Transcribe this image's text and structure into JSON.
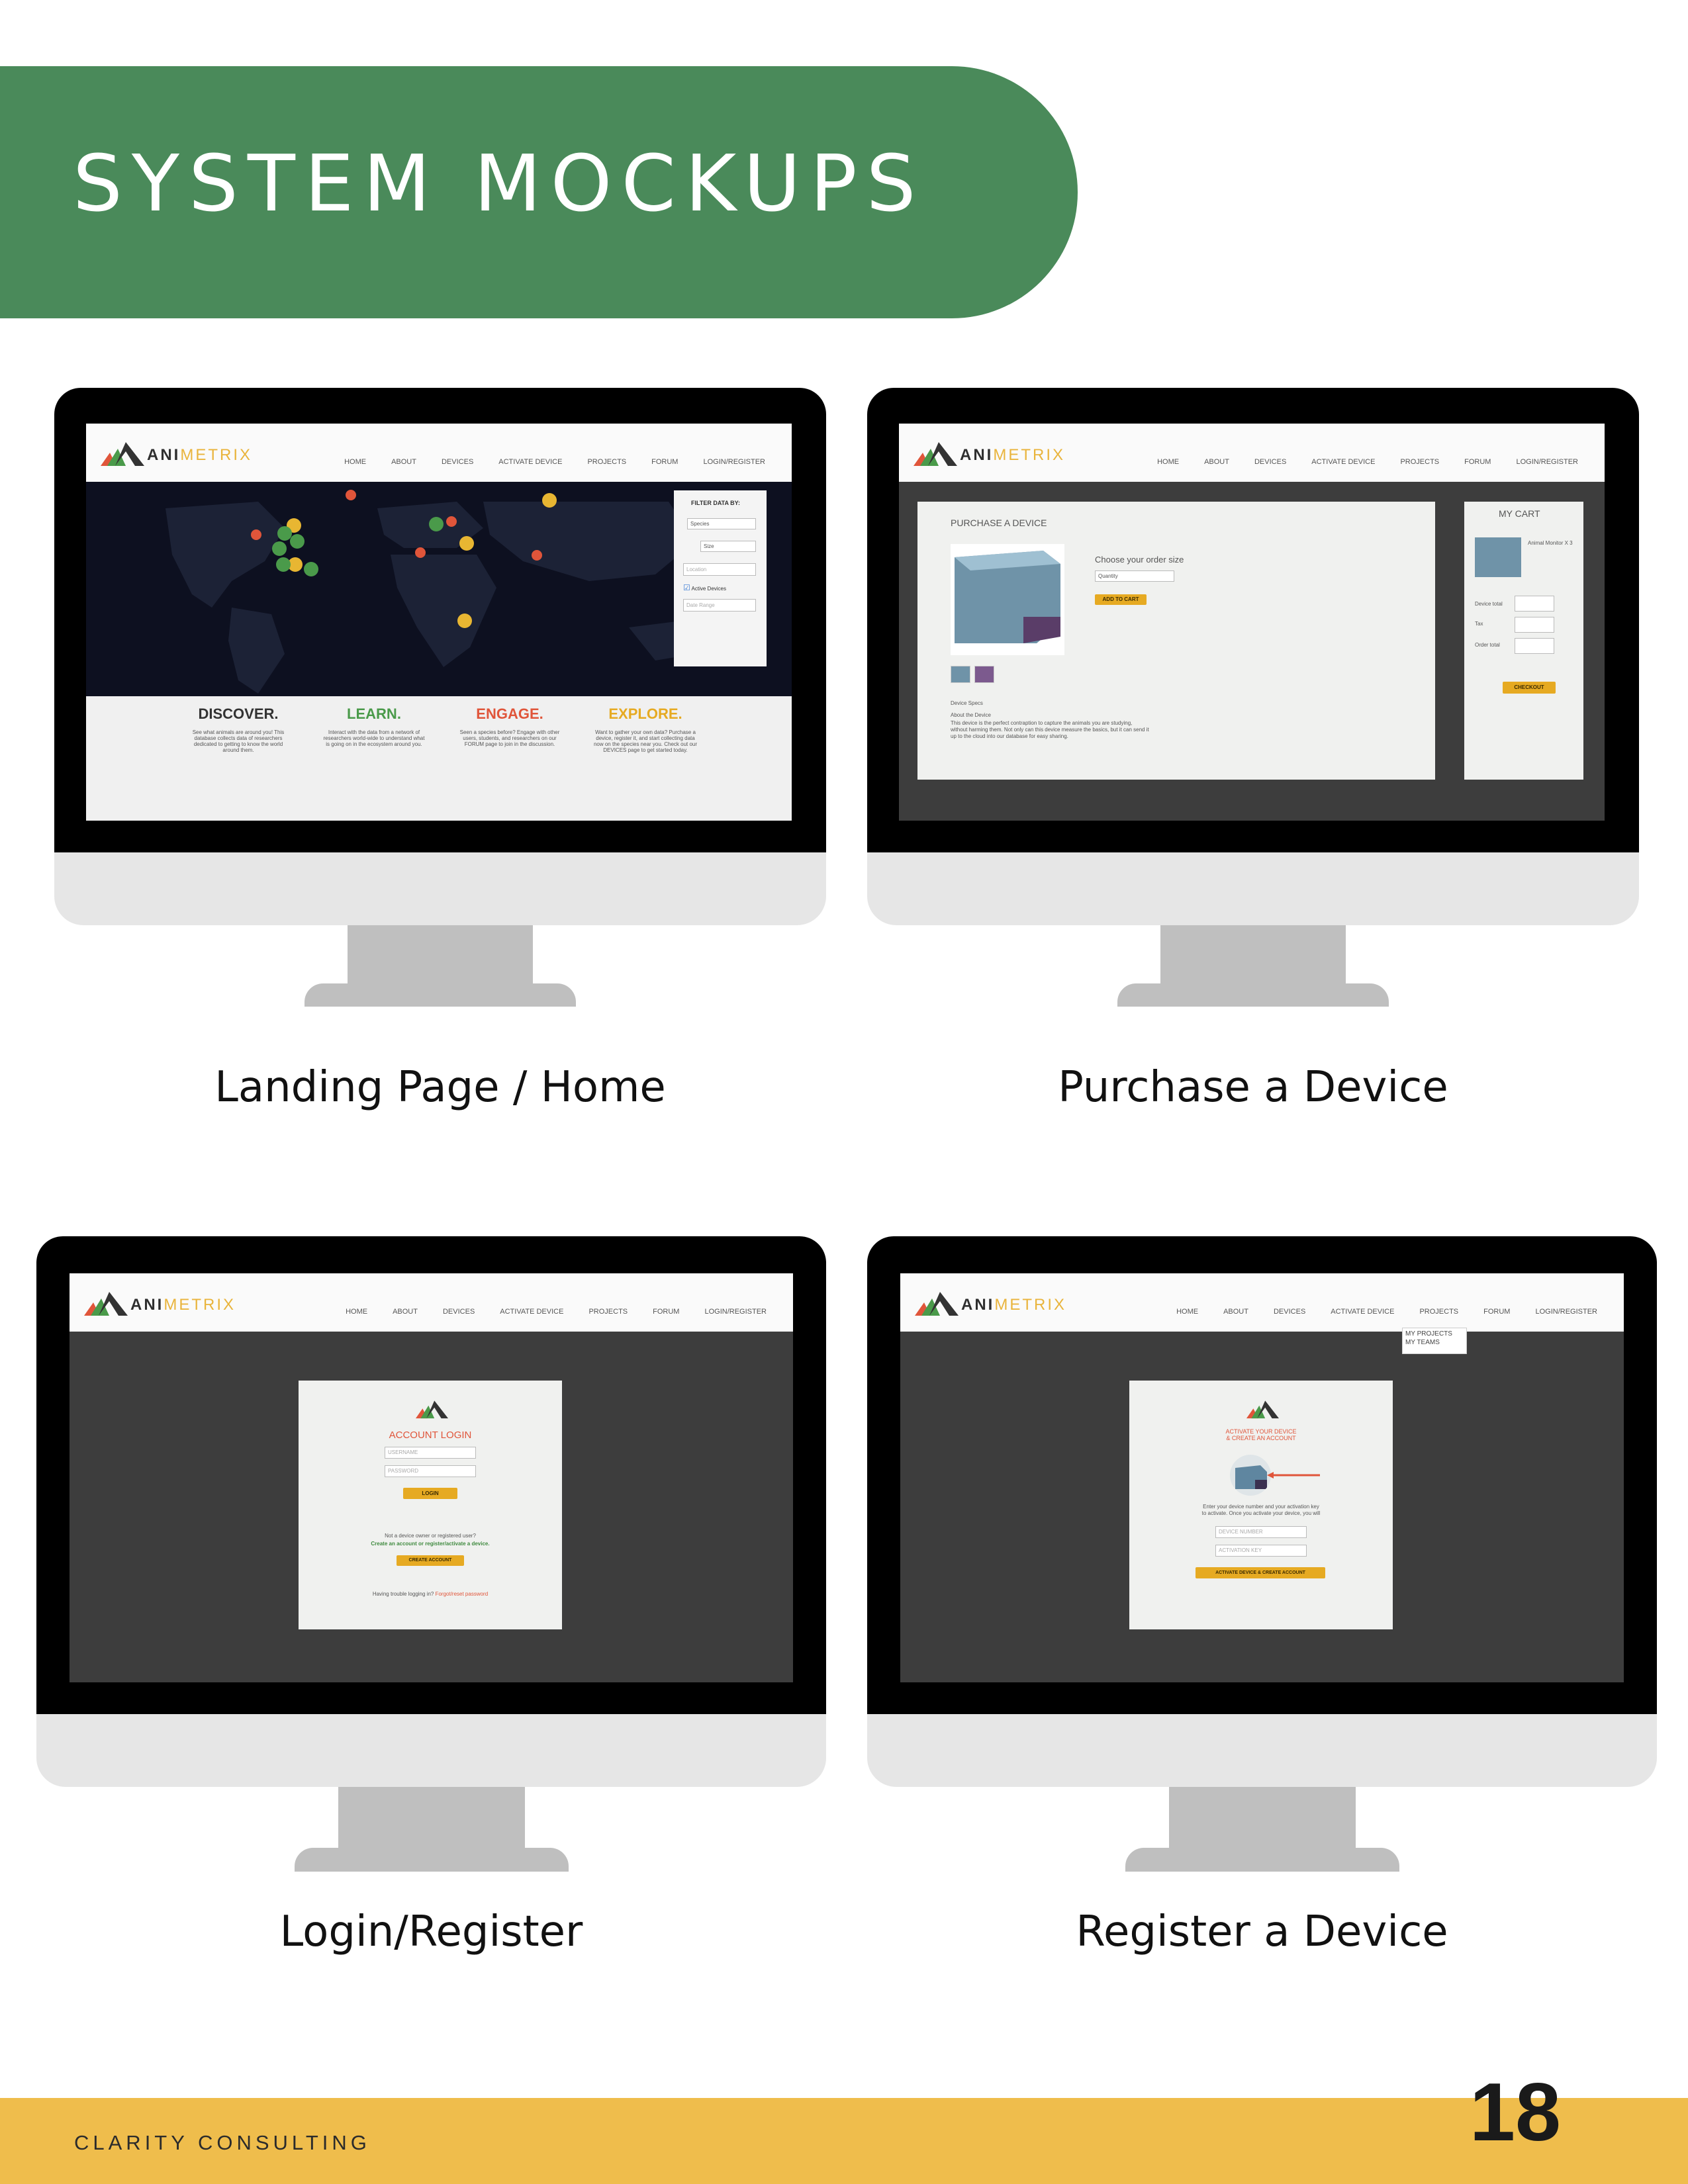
{
  "header": {
    "title": "SYSTEM MOCKUPS"
  },
  "brand": {
    "name_part1": "ANI",
    "name_part2": "METRIX"
  },
  "nav": [
    "HOME",
    "ABOUT",
    "DEVICES",
    "ACTIVATE DEVICE",
    "PROJECTS",
    "FORUM",
    "LOGIN/REGISTER"
  ],
  "landing": {
    "caption": "Landing Page / Home",
    "filter": {
      "title": "FILTER DATA BY:",
      "species": "Species",
      "size": "Size",
      "location": "Location",
      "active_devices": "Active Devices",
      "date_range": "Date Range"
    },
    "columns": [
      {
        "title": "DISCOVER.",
        "color": "#333333",
        "text": "See what animals are around you! This database collects data of researchers dedicated to getting to know the world around them."
      },
      {
        "title": "LEARN.",
        "color": "#4a9a4a",
        "text": "Interact with the data from a network of researchers world-wide to understand what is going on in the ecosystem around you."
      },
      {
        "title": "ENGAGE.",
        "color": "#e0553a",
        "text": "Seen a species before? Engage with other users, students, and researchers on our FORUM page to join in the discussion."
      },
      {
        "title": "EXPLORE.",
        "color": "#e6aa22",
        "text": "Want to gather your own data? Purchase a device, register it, and start collecting data now on the species near you. Check out our DEVICES page to get started today."
      }
    ]
  },
  "purchase": {
    "caption": "Purchase a Device",
    "heading": "PURCHASE A DEVICE",
    "order_heading": "Choose your order size",
    "quantity": "Quantity",
    "add_to_cart": "ADD TO CART",
    "specs_label": "Device Specs",
    "about_label": "About the Device",
    "about_text": "This device is the perfect contraption to capture the animals you are studying, without harming them. Not only can this device measure the basics, but it can send it up to the cloud into our database for easy sharing.",
    "cart": {
      "title": "MY CART",
      "item": "Animal Monitor X 3",
      "device_total": "Device total",
      "tax": "Tax",
      "order_total": "Order total",
      "checkout": "CHECKOUT"
    }
  },
  "login": {
    "caption": "Login/Register",
    "title": "ACCOUNT LOGIN",
    "username": "USERNAME",
    "password": "PASSWORD",
    "login_btn": "LOGIN",
    "not_owner": "Not a device owner or registered user?",
    "create_link": "Create an account or register/activate a device.",
    "create_btn": "CREATE ACCOUNT",
    "trouble": "Having trouble logging in?",
    "forgot": "Forgot/reset password"
  },
  "register": {
    "caption": "Register a Device",
    "title_line1": "ACTIVATE YOUR DEVICE",
    "title_line2": "& CREATE AN ACCOUNT",
    "instructions_line1": "Enter your device number and your activation key",
    "instructions_line2": "to activate. Once you activate your device, you will",
    "device_number": "DEVICE NUMBER",
    "activation_key": "ACTIVATION KEY",
    "activate_btn": "ACTIVATE DEVICE & CREATE ACCOUNT",
    "dropdown": [
      "MY PROJECTS",
      "MY TEAMS"
    ]
  },
  "footer": {
    "company": "CLARITY CONSULTING",
    "page": "18"
  },
  "colors": {
    "green": "#4a8a5a",
    "yellow": "#efbd4c",
    "orange": "#e6aa22",
    "red": "#e0553a"
  }
}
